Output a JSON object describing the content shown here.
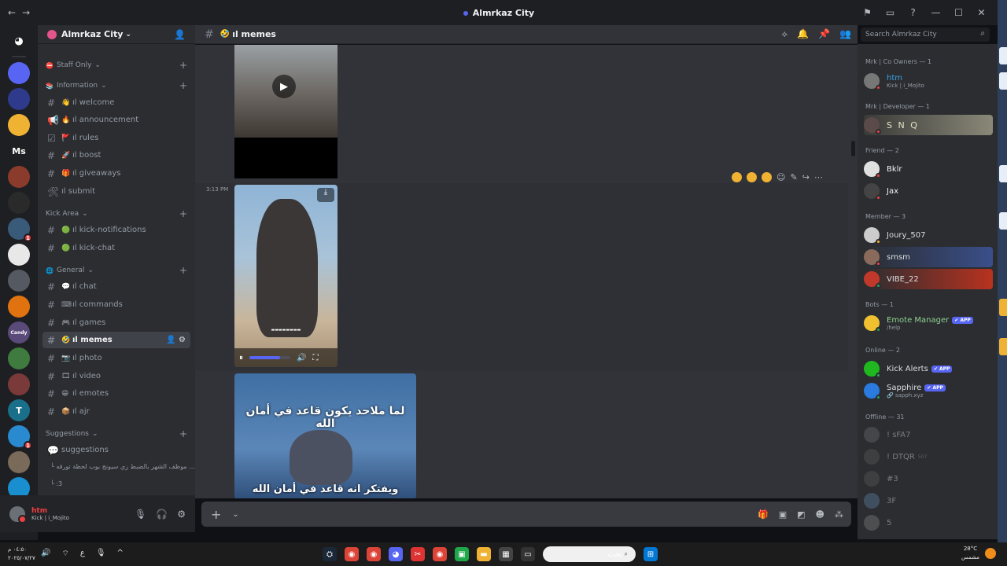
{
  "window": {
    "title": "Almrkaz City",
    "back_icon": "←",
    "forward_icon": "→",
    "controls": [
      "⚑",
      "▭",
      "?",
      "—",
      "☐",
      "✕"
    ]
  },
  "guilds": {
    "items": [
      {
        "label": "",
        "color": "#5865f2"
      },
      {
        "label": "",
        "color": "#2e3a8c"
      },
      {
        "label": "",
        "color": "#f0b232"
      },
      {
        "label": "Ms",
        "color": "#1e1f22"
      },
      {
        "label": "",
        "color": "#8a3b2c"
      },
      {
        "label": "",
        "color": "#2a2a2a"
      },
      {
        "label": "",
        "color": "#3a5a7a",
        "badge": "1"
      },
      {
        "label": "",
        "color": "#e8e8e8"
      },
      {
        "label": "",
        "color": "#555a62"
      },
      {
        "label": "",
        "color": "#e0720f"
      },
      {
        "label": "Candy",
        "color": "#5a4a7a"
      },
      {
        "label": "",
        "color": "#3f7a3f"
      },
      {
        "label": "",
        "color": "#7a3a3a"
      },
      {
        "label": "T",
        "color": "#1a6f8a"
      },
      {
        "label": "",
        "color": "#2a8ad0",
        "badge": "1"
      },
      {
        "label": "",
        "color": "#7a6a5a"
      },
      {
        "label": "",
        "color": "#1a8fd0"
      },
      {
        "label": "",
        "color": "#3a5aa0",
        "badge": "2"
      }
    ]
  },
  "server": {
    "name": "Almrkaz City",
    "categories": [
      {
        "label": "Staff Only",
        "emoji": "⛔"
      },
      {
        "label": "Information",
        "emoji": "📚"
      },
      {
        "label": "Kick Area",
        "emoji": ""
      },
      {
        "label": "General",
        "emoji": "🌐"
      },
      {
        "label": "Suggestions",
        "emoji": ""
      }
    ],
    "channels": [
      {
        "label": "ıl welcome",
        "emoji": "👋",
        "icon": "#"
      },
      {
        "label": "ıl announcement",
        "emoji": "🔥",
        "icon": "📢"
      },
      {
        "label": "ıl rules",
        "emoji": "🚩",
        "icon": "☑"
      },
      {
        "label": "ıl boost",
        "emoji": "🚀",
        "icon": "#"
      },
      {
        "label": "ıl giveaways",
        "emoji": "🎁",
        "icon": "#"
      },
      {
        "label": "ıl submit",
        "emoji": "",
        "icon": "🛠"
      },
      {
        "label": "ıl kick-notifications",
        "emoji": "🟢",
        "icon": "#"
      },
      {
        "label": "ıl kick-chat",
        "emoji": "🟢",
        "icon": "#"
      },
      {
        "label": "ıl chat",
        "emoji": "💬",
        "icon": "#"
      },
      {
        "label": "ıl commands",
        "emoji": "⌨",
        "icon": "#"
      },
      {
        "label": "ıl games",
        "emoji": "🎮",
        "icon": "#"
      },
      {
        "label": "ıl memes",
        "emoji": "🤣",
        "icon": "#",
        "active": true
      },
      {
        "label": "ıl photo",
        "emoji": "📷",
        "icon": "#"
      },
      {
        "label": "ıl video",
        "emoji": "🎞",
        "icon": "#"
      },
      {
        "label": "ıl emotes",
        "emoji": "😁",
        "icon": "#"
      },
      {
        "label": "ıl ajr",
        "emoji": "📦",
        "icon": "#"
      },
      {
        "label": "suggestions",
        "emoji": "",
        "icon": "💬"
      }
    ],
    "threads": [
      "موظف الشهر بالضبط زي سيونج بوب لحظة تورقه ...",
      ":3"
    ]
  },
  "user": {
    "name": "htm",
    "status": "Kick | i_Mojito"
  },
  "chat": {
    "channel_name": "ıl memes",
    "search_placeholder": "Search Almrkaz City",
    "timestamp": "3:13 PM",
    "caption_top": "لما ملاحد يكون قاعد في أمان الله",
    "caption_bottom": "ويفتكر انه قاعد في أمان الله",
    "video_progress": 0.75
  },
  "members": {
    "sections": [
      {
        "label": "Mrk | Co Owners — 1"
      },
      {
        "label": "Mrk | Developer — 1"
      },
      {
        "label": "Friend — 2"
      },
      {
        "label": "Member — 3"
      },
      {
        "label": "Bots — 1"
      },
      {
        "label": "Online — 2"
      },
      {
        "label": "Offline — 31"
      }
    ],
    "list": [
      {
        "name": "htm",
        "sub": "Kick | i_Mojito",
        "color": "#3ba0e0",
        "avatar": "#777"
      },
      {
        "name": "S N Q",
        "sub": "",
        "color": "#e8e2c8",
        "avatar": "#5a4a4a"
      },
      {
        "name": "Bklr",
        "sub": "",
        "color": "#f2f3f5",
        "avatar": "#e0e0e0"
      },
      {
        "name": "Jax",
        "sub": "",
        "color": "#f2f3f5",
        "avatar": "#444"
      },
      {
        "name": "Joury_507",
        "sub": "",
        "color": "#dbdee1",
        "avatar": "#ccc"
      },
      {
        "name": "smsm",
        "sub": "",
        "color": "#dbdee1",
        "avatar": "#8a6a5a"
      },
      {
        "name": "VIBE_22",
        "sub": "",
        "color": "#dbdee1",
        "avatar": "#c0392b"
      },
      {
        "name": "Emote Manager",
        "sub": "/help",
        "color": "#8fd18f",
        "avatar": "#f0c030",
        "app": "✔ APP"
      },
      {
        "name": "Kick Alerts",
        "sub": "",
        "color": "#dbdee1",
        "avatar": "#1fb81f",
        "app": "✔ APP"
      },
      {
        "name": "Sapphire",
        "sub": "🔗 sapph.xyz",
        "color": "#dbdee1",
        "avatar": "#2a7ae0",
        "app": "✔ APP"
      },
      {
        "name": "! sFA7",
        "sub": "",
        "color": "#dbdee1",
        "avatar": "#666"
      },
      {
        "name": "! DTQR",
        "sub": "",
        "color": "#dbdee1",
        "avatar": "#555",
        "tag": "507"
      },
      {
        "name": "#3",
        "sub": "",
        "color": "#dbdee1",
        "avatar": "#555"
      },
      {
        "name": "3F",
        "sub": "",
        "color": "#dbdee1",
        "avatar": "#5a7a9a"
      },
      {
        "name": "5",
        "sub": "",
        "color": "#dbdee1",
        "avatar": "#777"
      }
    ]
  },
  "taskbar": {
    "time": "٠٤:٥٠ م",
    "date": "٢٠٢٥/٠٧/٢٧",
    "search_text": "بحث",
    "weather_temp": "28°C",
    "weather_desc": "مشمس",
    "lang": "ع"
  }
}
